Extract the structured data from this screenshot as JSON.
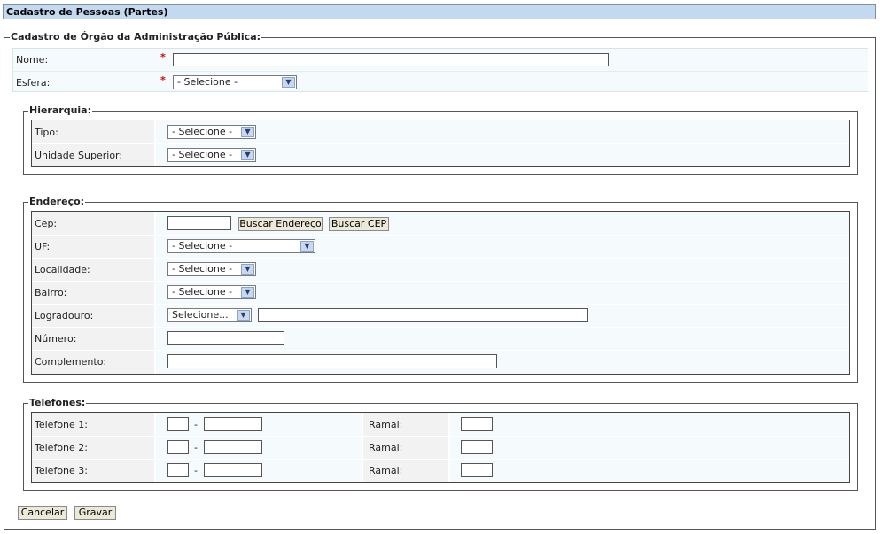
{
  "page_title": "Cadastro de Pessoas (Partes)",
  "form_legend": "Cadastro de Órgão da Administração Pública:",
  "required_mark": "*",
  "nome": {
    "label": "Nome:",
    "value": ""
  },
  "esfera": {
    "label": "Esfera:",
    "selected": "- Selecione -"
  },
  "hierarquia": {
    "legend": "Hierarquia:",
    "tipo": {
      "label": "Tipo:",
      "selected": "- Selecione -"
    },
    "unidade_superior": {
      "label": "Unidade Superior:",
      "selected": "- Selecione -"
    }
  },
  "endereco": {
    "legend": "Endereço:",
    "cep": {
      "label": "Cep:",
      "value": ""
    },
    "buscar_endereco": "Buscar Endereço",
    "buscar_cep": "Buscar CEP",
    "uf": {
      "label": "UF:",
      "selected": "- Selecione -"
    },
    "localidade": {
      "label": "Localidade:",
      "selected": "- Selecione -"
    },
    "bairro": {
      "label": "Bairro:",
      "selected": "- Selecione -"
    },
    "logradouro": {
      "label": "Logradouro:",
      "selected": "Selecione...",
      "value": ""
    },
    "numero": {
      "label": "Número:",
      "value": ""
    },
    "complemento": {
      "label": "Complemento:",
      "value": ""
    }
  },
  "telefones": {
    "legend": "Telefones:",
    "separator": "-",
    "rows": [
      {
        "label": "Telefone 1:",
        "ramal_label": "Ramal:"
      },
      {
        "label": "Telefone 2:",
        "ramal_label": "Ramal:"
      },
      {
        "label": "Telefone 3:",
        "ramal_label": "Ramal:"
      }
    ]
  },
  "buttons": {
    "cancelar": "Cancelar",
    "gravar": "Gravar"
  },
  "colors": {
    "title_bg": "#c3d9ef",
    "required": "#dd0000",
    "field_bg": "#f5fbfd",
    "label_bg": "#f2f2f2"
  },
  "icons": {
    "dropdown": "chevron-down-icon"
  }
}
